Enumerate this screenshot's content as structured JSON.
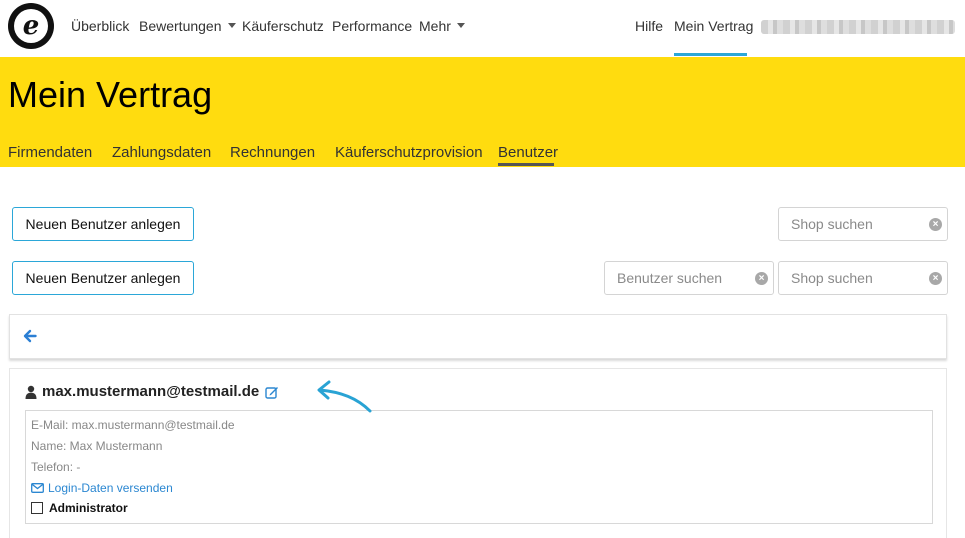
{
  "nav": {
    "items": [
      "Überblick",
      "Bewertungen",
      "Käuferschutz",
      "Performance",
      "Mehr"
    ],
    "help": "Hilfe",
    "contract": "Mein Vertrag",
    "accent_color": "#2ba7d8"
  },
  "header": {
    "title": "Mein Vertrag",
    "background": "#ffdc0f",
    "tabs": [
      "Firmendaten",
      "Zahlungsdaten",
      "Rechnungen",
      "Käuferschutzprovision",
      "Benutzer"
    ],
    "active_tab": "Benutzer"
  },
  "toolbar1": {
    "new_user_label": "Neuen Benutzer anlegen",
    "shop_placeholder": "Shop suchen"
  },
  "toolbar2": {
    "new_user_label": "Neuen Benutzer anlegen",
    "user_placeholder": "Benutzer suchen",
    "shop_placeholder": "Shop suchen"
  },
  "user": {
    "email_title": "max.mustermann@testmail.de",
    "email_line": "E-Mail: max.mustermann@testmail.de",
    "name_line": "Name: Max Mustermann",
    "phone_line": "Telefon: -",
    "send_login": "Login-Daten versenden",
    "admin_label": "Administrator",
    "admin_checked": false
  },
  "icons": [
    "trusted-shops-logo",
    "arrow-left-icon",
    "user-icon",
    "edit-icon",
    "envelope-icon",
    "clear-icon",
    "checkbox"
  ]
}
